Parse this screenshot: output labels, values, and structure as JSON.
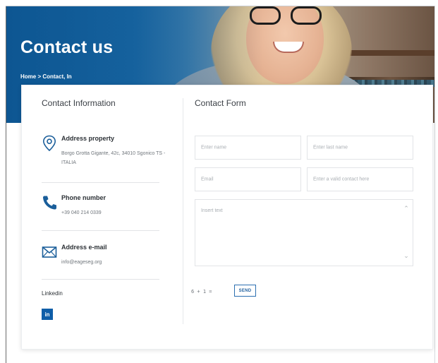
{
  "hero": {
    "title": "Contact us",
    "breadcrumb": "Home > Contact, In"
  },
  "contact_info": {
    "title": "Contact Information",
    "address": {
      "heading": "Address property",
      "text": "Borgo Grotta Gigante, 42c, 34010 Sgonico TS - ITALIA",
      "icon": "location-pin-icon"
    },
    "phone": {
      "heading": "Phone number",
      "text": "+39 040 214 0339",
      "icon": "phone-icon"
    },
    "email": {
      "heading": "Address e-mail",
      "text": "info@eageseg.org",
      "icon": "envelope-icon"
    },
    "linkedin": {
      "label": "Linkedin",
      "button_text": "in",
      "icon": "linkedin-icon"
    }
  },
  "contact_form": {
    "title": "Contact Form",
    "fields": {
      "first_name_placeholder": "Enter name",
      "last_name_placeholder": "Enter last name",
      "email_placeholder": "Email",
      "contact_placeholder": "Enter a valid contact here",
      "message_placeholder": "Insert text"
    },
    "captcha": "6 + 1 =",
    "send_label": "SEND"
  },
  "colors": {
    "brand_blue": "#0f5ea8",
    "hero_blue": "#0f5e9a",
    "icon_blue": "#1a5e9a"
  }
}
